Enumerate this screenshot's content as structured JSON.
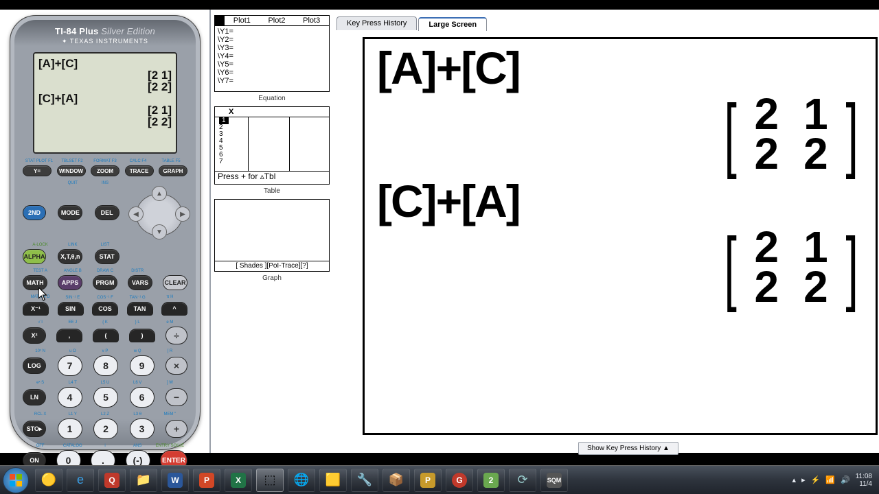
{
  "calculator": {
    "model_bold": "TI-84 Plus",
    "model_edition": "Silver Edition",
    "brand": "✦ TEXAS INSTRUMENTS",
    "lcd": {
      "l1": "[A]+[C]",
      "m1a": "[2 1]",
      "m1b": "[2 2]",
      "l2": "[C]+[A]",
      "m2a": "[2 1]",
      "m2b": "[2 2]"
    },
    "fn_labels": [
      "STAT PLOT F1",
      "TBLSET F2",
      "FORMAT F3",
      "CALC F4",
      "TABLE F5"
    ],
    "top_keys": [
      "Y=",
      "WINDOW",
      "ZOOM",
      "TRACE",
      "GRAPH"
    ],
    "row2_sub": [
      [
        "",
        "QUIT",
        "INS"
      ],
      [
        "",
        "",
        ""
      ]
    ],
    "row2": [
      "2ND",
      "MODE",
      "DEL"
    ],
    "row3_sub": [
      "A-LOCK",
      "LINK",
      "LIST"
    ],
    "row3": [
      "ALPHA",
      "X,T,θ,n",
      "STAT"
    ],
    "row4_sub": [
      "TEST A",
      "ANGLE B",
      "DRAW C",
      "DISTR",
      ""
    ],
    "row4": [
      "MATH",
      "APPS",
      "PRGM",
      "VARS",
      "CLEAR"
    ],
    "row5_sub": [
      "MATRIX D",
      "SIN⁻¹ E",
      "COS⁻¹ F",
      "TAN⁻¹ G",
      "π H"
    ],
    "row5": [
      "X⁻¹",
      "SIN",
      "COS",
      "TAN",
      "^"
    ],
    "row6_sub": [
      "√  I",
      "EE J",
      "{  K",
      "}  L",
      "e  M"
    ],
    "row6": [
      "X²",
      ",",
      "(",
      ")",
      "÷"
    ],
    "row7_sub": [
      "10ˣ N",
      "u  O",
      "v  P",
      "w  Q",
      "[  R"
    ],
    "row7": [
      "LOG",
      "7",
      "8",
      "9",
      "×"
    ],
    "row8_sub": [
      "eˣ S",
      "L4 T",
      "L5 U",
      "L6 V",
      "]  W"
    ],
    "row8": [
      "LN",
      "4",
      "5",
      "6",
      "−"
    ],
    "row9_sub": [
      "RCL X",
      "L1 Y",
      "L2 Z",
      "L3 θ",
      "MEM \""
    ],
    "row9": [
      "STO▸",
      "1",
      "2",
      "3",
      "+"
    ],
    "row10_sub": [
      "OFF",
      "CATALOG",
      "i",
      "ANS",
      "ENTRY SOLVE"
    ],
    "row10": [
      "ON",
      "0",
      ".",
      "(-)",
      "ENTER"
    ]
  },
  "mid": {
    "equation_caption": "Equation",
    "table_caption": "Table",
    "graph_caption": "Graph",
    "plots": [
      "Plot1",
      "Plot2",
      "Plot3"
    ],
    "ylines": [
      "\\Y1=",
      "\\Y2=",
      "\\Y3=",
      "\\Y4=",
      "\\Y5=",
      "\\Y6=",
      "\\Y7="
    ],
    "table_x": "X",
    "table_nums": [
      "1",
      "2",
      "3",
      "4",
      "5",
      "6",
      "7"
    ],
    "table_foot": "Press + for ▵Tbl",
    "graph_foot": "[ Shades ][PoI-Trace][?]"
  },
  "tabs": {
    "kph": "Key Press History",
    "large": "Large Screen"
  },
  "large": {
    "e1": "[A]+[C]",
    "m1": [
      [
        "2",
        "1"
      ],
      [
        "2",
        "2"
      ]
    ],
    "e2": "[C]+[A]",
    "m2": [
      [
        "2",
        "1"
      ],
      [
        "2",
        "2"
      ]
    ]
  },
  "show_kph": "Show Key Press History ▲",
  "taskbar": {
    "time": "11:08",
    "date": "11/4"
  }
}
